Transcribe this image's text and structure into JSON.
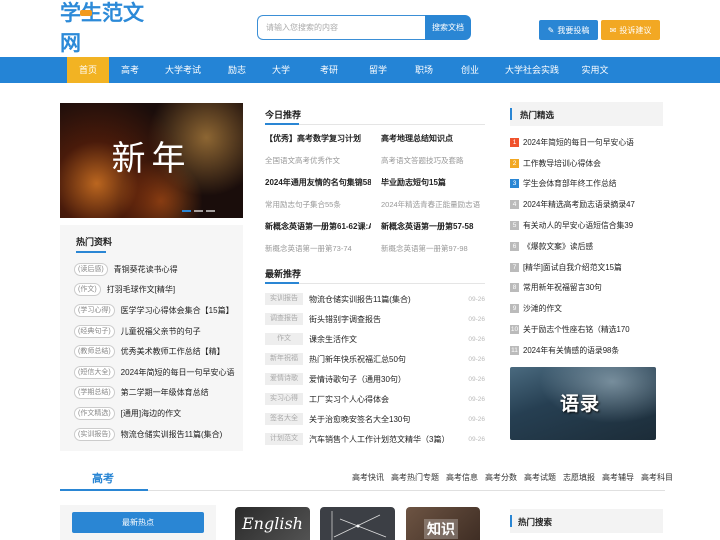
{
  "header": {
    "logo_text": "学生范文网",
    "search_placeholder": "请输入您搜索的内容",
    "search_button": "搜索文档",
    "submit_button": "我要投稿",
    "suggest_button": "投诉建议"
  },
  "nav": {
    "items": [
      "首页",
      "高考",
      "大学考试",
      "励志",
      "大学",
      "考研",
      "留学",
      "职场",
      "创业",
      "大学社会实践",
      "实用文"
    ],
    "active": "首页"
  },
  "banner": {
    "text": "新年"
  },
  "hot_info": {
    "title": "热门资料",
    "items": [
      {
        "tag": "读后感",
        "title": "青铜葵花读书心得"
      },
      {
        "tag": "作文",
        "title": "打羽毛球作文[精华]"
      },
      {
        "tag": "学习心得",
        "title": "医学学习心得体会集合【15篇】"
      },
      {
        "tag": "经典句子",
        "title": "儿童祝福父亲节的句子"
      },
      {
        "tag": "教师总结",
        "title": "优秀美术教师工作总结【精】"
      },
      {
        "tag": "短信大全",
        "title": "2024年简短的每日一句早安心语"
      },
      {
        "tag": "学期总结",
        "title": "第二学期一年级体育总结"
      },
      {
        "tag": "作文精选",
        "title": "[通用]海边的作文"
      },
      {
        "tag": "实训报告",
        "title": "物流仓储实训报告11篇(集合)"
      }
    ]
  },
  "today": {
    "title": "今日推荐",
    "items": [
      {
        "title": "【优秀】高考数学复习计划",
        "sub": "全国语文高考优秀作文"
      },
      {
        "title": "高考地理总结知识点",
        "sub": "高考语文答题技巧及套路"
      },
      {
        "title": "2024年通用友情的名句集锦58",
        "sub": "常用励志句子集合55条"
      },
      {
        "title": "毕业励志短句15篇",
        "sub": "2024年精选青春正能量励志语"
      },
      {
        "title": "新概念英语第一册第61-62课:A",
        "sub": "新概念英语第一册第73-74"
      },
      {
        "title": "新概念英语第一册第57-58",
        "sub": "新概念英语第一册第97-98"
      }
    ]
  },
  "latest": {
    "title": "最新推荐",
    "items": [
      {
        "tag": "实训报告",
        "title": "物流仓储实训报告11篇(集合)",
        "date": "09-26"
      },
      {
        "tag": "调查报告",
        "title": "街头错别字调查报告",
        "date": "09-26"
      },
      {
        "tag": "作文",
        "title": "课余生活作文",
        "date": "09-26"
      },
      {
        "tag": "新年祝福",
        "title": "热门新年快乐祝福汇总50句",
        "date": "09-26"
      },
      {
        "tag": "爱情诗歌",
        "title": "爱情诗歌句子（通用30句）",
        "date": "09-26"
      },
      {
        "tag": "实习心得",
        "title": "工厂实习个人心得体会",
        "date": "09-26"
      },
      {
        "tag": "签名大全",
        "title": "关于治愈晚安签名大全130句",
        "date": "09-26"
      },
      {
        "tag": "计划范文",
        "title": "汽车销售个人工作计划范文精华（3篇）",
        "date": "09-26"
      }
    ]
  },
  "hot_select": {
    "title": "热门精选",
    "items": [
      "2024年简短的每日一句早安心语",
      "工作教导培训心得体会",
      "学生会体育部年终工作总结",
      "2024年精选高考励志语录摘录47",
      "有关动人的早安心语短信合集39",
      "《爆款文案》读后感",
      "[精华]面试自我介绍范文15篇",
      "常用新年祝福留言30句",
      "沙滩的作文",
      "关于励志个性座右铭（精选170",
      "2024年有关情感的语录98条"
    ],
    "colors": [
      "#f0522c",
      "#f2a823",
      "#2a86d4",
      "#bbbbbb"
    ]
  },
  "quotes_image": {
    "text": "语录"
  },
  "gaokao": {
    "title": "高考",
    "links": [
      "高考快讯",
      "高考热门专题",
      "高考信息",
      "高考分数",
      "高考试题",
      "志愿填报",
      "高考辅导",
      "高考科目"
    ],
    "button": "最新热点",
    "thumb1_text": "English",
    "thumb3_text": "知识",
    "hot_search_title": "热门搜索"
  }
}
